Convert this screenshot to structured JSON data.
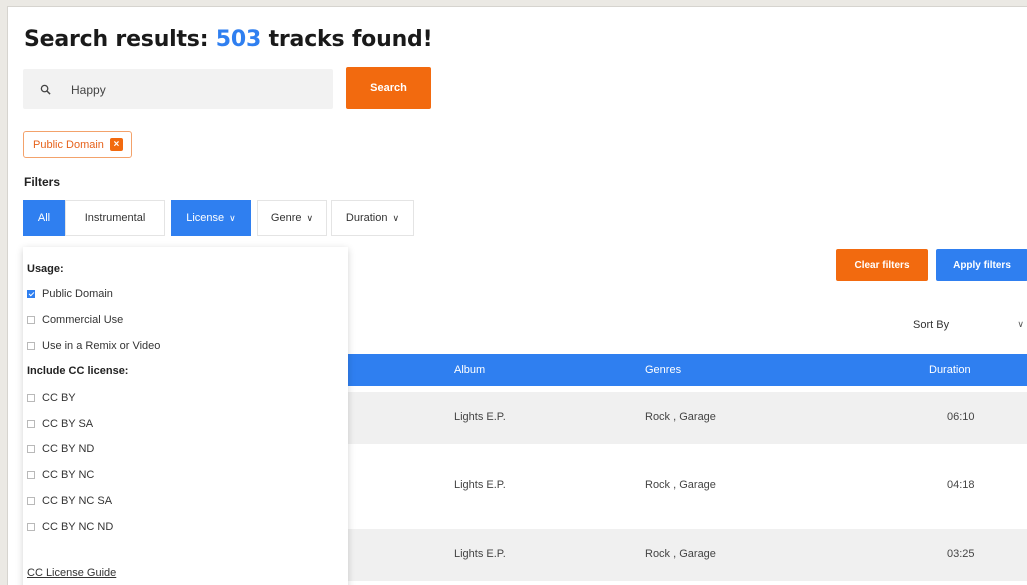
{
  "header": {
    "title_prefix": "Search results:",
    "count": "503",
    "title_suffix": "tracks found!"
  },
  "search": {
    "value": "Happy",
    "button_label": "Search",
    "icon": "search-icon"
  },
  "active_chip": {
    "label": "Public Domain",
    "remove_icon": "close-icon"
  },
  "filters": {
    "heading": "Filters",
    "buttons": [
      {
        "label": "All",
        "active": true
      },
      {
        "label": "Instrumental",
        "active": false
      },
      {
        "label": "License",
        "active": true,
        "has_chevron": true
      },
      {
        "label": "Genre",
        "active": false,
        "has_chevron": true
      },
      {
        "label": "Duration",
        "active": false,
        "has_chevron": true
      }
    ]
  },
  "license_dropdown": {
    "usage_heading": "Usage:",
    "usage_options": [
      {
        "label": "Public Domain",
        "checked": true
      },
      {
        "label": "Commercial Use",
        "checked": false
      },
      {
        "label": "Use in a Remix or Video",
        "checked": false
      }
    ],
    "cc_heading": "Include CC license:",
    "cc_options": [
      {
        "label": "CC BY",
        "checked": false
      },
      {
        "label": "CC BY SA",
        "checked": false
      },
      {
        "label": "CC BY ND",
        "checked": false
      },
      {
        "label": "CC BY NC",
        "checked": false
      },
      {
        "label": "CC BY NC SA",
        "checked": false
      },
      {
        "label": "CC BY NC ND",
        "checked": false
      }
    ],
    "guide_link": "CC License Guide"
  },
  "actions": {
    "clear_label": "Clear filters",
    "apply_label": "Apply filters"
  },
  "sort": {
    "label": "Sort By"
  },
  "table": {
    "columns": {
      "album": "Album",
      "genres": "Genres",
      "duration": "Duration"
    },
    "rows": [
      {
        "album": "Lights E.P.",
        "genres": "Rock , Garage",
        "duration": "06:10"
      },
      {
        "album": "Lights E.P.",
        "genres": "Rock , Garage",
        "duration": "04:18"
      },
      {
        "album": "Lights E.P.",
        "genres": "Rock , Garage",
        "duration": "03:25"
      }
    ]
  },
  "colors": {
    "accent_blue": "#2f7ff0",
    "accent_orange": "#f26a0f"
  }
}
